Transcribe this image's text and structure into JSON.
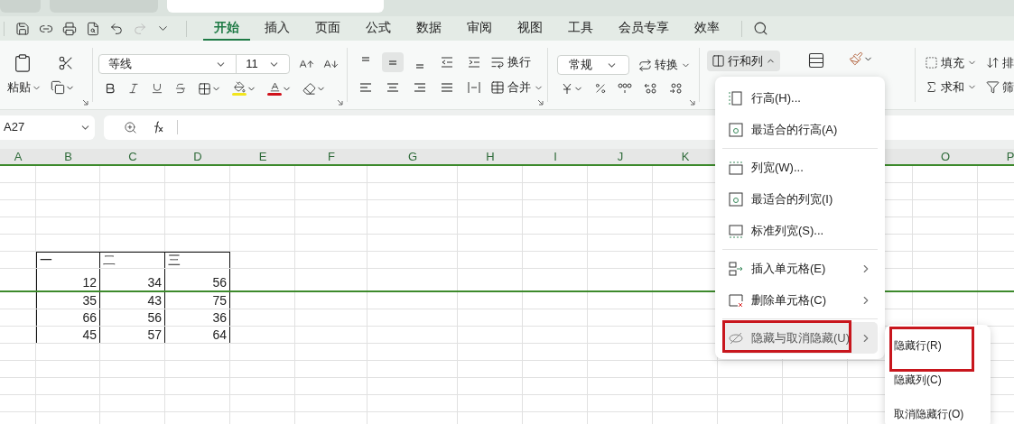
{
  "window_tabs": [
    {
      "selected": false
    },
    {
      "selected": false
    },
    {
      "selected": true
    }
  ],
  "quick_access": {
    "redo_disabled": true
  },
  "ribbon_tabs": [
    {
      "label": "开始",
      "selected": true
    },
    {
      "label": "插入",
      "selected": false
    },
    {
      "label": "页面",
      "selected": false
    },
    {
      "label": "公式",
      "selected": false
    },
    {
      "label": "数据",
      "selected": false
    },
    {
      "label": "审阅",
      "selected": false
    },
    {
      "label": "视图",
      "selected": false
    },
    {
      "label": "工具",
      "selected": false
    },
    {
      "label": "会员专享",
      "selected": false
    },
    {
      "label": "效率",
      "selected": false
    }
  ],
  "ribbon": {
    "paste": "粘贴",
    "font_name": "等线",
    "font_size": "11",
    "align_middle_selected": true,
    "wrap": "换行",
    "merge": "合并",
    "number_format": "常规",
    "convert": "转换",
    "rows_columns": {
      "label": "行和列",
      "expanded": true
    },
    "fill": "填充",
    "sum": "求和",
    "sort": "排",
    "filter": "筛"
  },
  "formula_bar": {
    "name_box": "A27"
  },
  "columns": [
    "A",
    "B",
    "C",
    "D",
    "E",
    "F",
    "G",
    "H",
    "I",
    "J",
    "K",
    "O",
    "P"
  ],
  "table": {
    "header": [
      "一",
      "二",
      "三"
    ],
    "rows": [
      {
        "cells": [
          "12",
          "34",
          "56"
        ],
        "hidden_rows_after": true
      },
      {
        "cells": [
          "35",
          "43",
          "75"
        ],
        "hidden_rows_after": false
      },
      {
        "cells": [
          "66",
          "56",
          "36"
        ],
        "hidden_rows_after": false
      },
      {
        "cells": [
          "45",
          "57",
          "64"
        ],
        "hidden_rows_after": false
      }
    ]
  },
  "menu": {
    "groups": [
      [
        {
          "label": "行高(H)...",
          "submenu": false,
          "hovered": false,
          "marked": false
        },
        {
          "label": "最适合的行高(A)",
          "submenu": false,
          "hovered": false,
          "marked": false
        }
      ],
      [
        {
          "label": "列宽(W)...",
          "submenu": false,
          "hovered": false,
          "marked": false
        },
        {
          "label": "最适合的列宽(I)",
          "submenu": false,
          "hovered": false,
          "marked": false
        },
        {
          "label": "标准列宽(S)...",
          "submenu": false,
          "hovered": false,
          "marked": false
        }
      ],
      [
        {
          "label": "插入单元格(E)",
          "submenu": true,
          "hovered": false,
          "marked": false
        },
        {
          "label": "删除单元格(C)",
          "submenu": true,
          "hovered": false,
          "marked": false
        }
      ],
      [
        {
          "label": "隐藏与取消隐藏(U)",
          "submenu": true,
          "hovered": true,
          "marked": true
        }
      ]
    ]
  },
  "submenu": [
    {
      "label": "隐藏行(R)",
      "marked": true
    },
    {
      "label": "隐藏列(C)",
      "marked": false
    },
    {
      "label": "取消隐藏行(O)",
      "marked": false
    }
  ]
}
